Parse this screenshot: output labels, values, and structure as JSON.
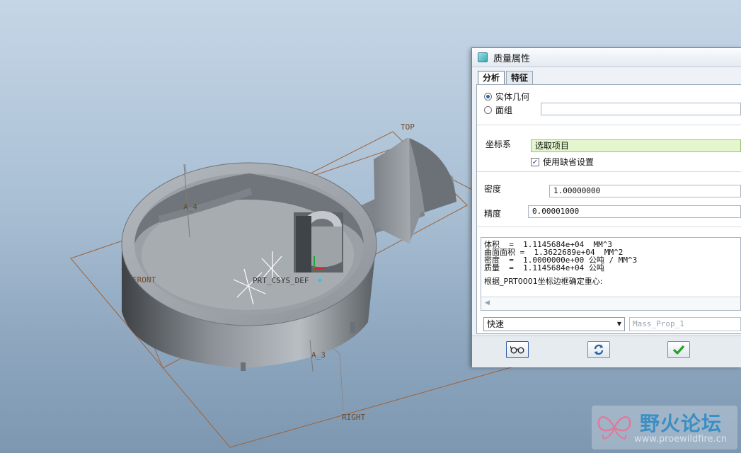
{
  "viewport": {
    "datum_labels": [
      "TOP",
      "A_4",
      "FRONT",
      "PRT_CSYS_DEF",
      "A_3",
      "RIGHT"
    ]
  },
  "dialog": {
    "title": "质量属性",
    "tabs": [
      {
        "label": "分析",
        "active": true
      },
      {
        "label": "特征",
        "active": false
      }
    ],
    "geometry_options": [
      {
        "label": "实体几何",
        "selected": true
      },
      {
        "label": "面组",
        "selected": false
      }
    ],
    "quilt_field_value": "",
    "coord_system": {
      "label": "坐标系",
      "field_value": "选取项目",
      "use_default_label": "使用缺省设置",
      "use_default_checked": true
    },
    "density": {
      "label": "密度",
      "value": "1.00000000"
    },
    "accuracy": {
      "label": "精度",
      "value": "0.00001000"
    },
    "results": [
      "体积  =  1.1145684e+04  MM^3",
      "曲面面积 =  1.3622689e+04  MM^2",
      "密度  =  1.0000000e+00 公吨 / MM^3",
      "质量  =  1.1145684e+04 公吨"
    ],
    "results_note": "根据_PRT0001坐标边框确定重心:",
    "mode_select": "快速",
    "analysis_name": "Mass_Prop_1",
    "colors": {
      "accent_green": "#e3f6cd",
      "ok_green": "#2a9d2a",
      "refresh_blue": "#2d63a8"
    }
  },
  "watermark": {
    "title": "野火论坛",
    "url": "www.proewildfire.cn"
  }
}
